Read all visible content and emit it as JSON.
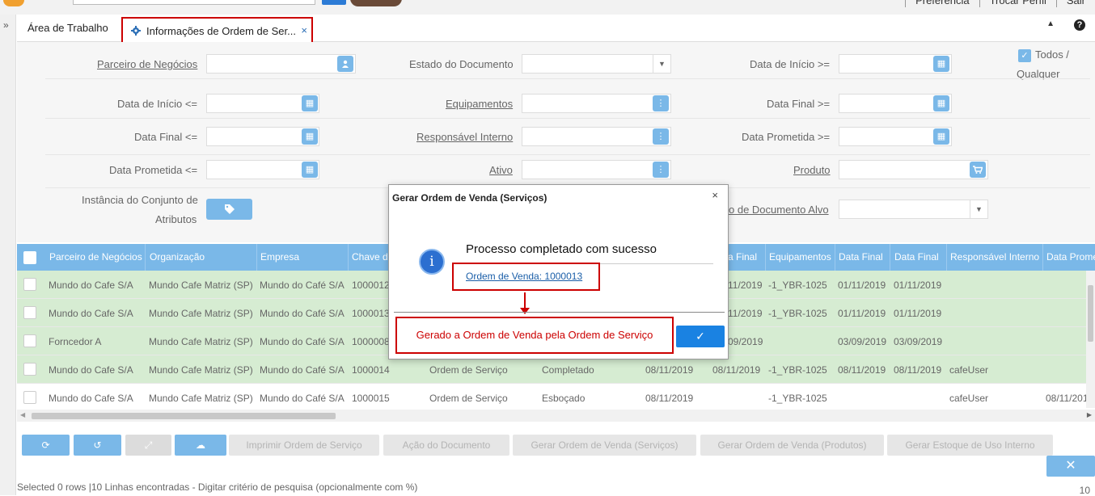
{
  "topbar": {
    "links": [
      "Preferência",
      "Trocar Perfil",
      "Sair"
    ]
  },
  "tabs": {
    "tab1": "Área de Trabalho",
    "tab2": "Informações de Ordem de Ser...",
    "close": "×",
    "up": "▲",
    "help": "?"
  },
  "leftstrip": {
    "chevron": "»"
  },
  "filters": {
    "parceiro": "Parceiro de Negócios",
    "estado": "Estado do Documento",
    "data_inicio_ge": "Data de Início >=",
    "todos": "Todos /",
    "qualquer": "Qualquer",
    "data_inicio_le": "Data de Início <=",
    "equipamentos": "Equipamentos",
    "data_final_ge": "Data Final >=",
    "data_final_le": "Data Final <=",
    "responsavel": "Responsável Interno",
    "data_prometida_ge": "Data Prometida >=",
    "data_prometida_le": "Data Prometida <=",
    "ativo": "Ativo",
    "produto": "Produto",
    "instancia_1": "Instância do Conjunto de",
    "instancia_2": "Atributos",
    "tipo_documento_alvo": "o de Documento Alvo"
  },
  "grid": {
    "headers": [
      "Parceiro de Negócios",
      "Organização",
      "Empresa",
      "Chave d",
      "a Final",
      "Equipamentos",
      "Data Final",
      "Data Final",
      "Responsável Interno",
      "Data Prome"
    ],
    "rows": [
      [
        "Mundo do Cafe S/A",
        "Mundo Cafe Matriz (SP)",
        "Mundo do Café S/A",
        "1000012",
        "",
        "",
        "",
        "11/2019",
        "-1_YBR-1025",
        "01/11/2019",
        "01/11/2019",
        "",
        ""
      ],
      [
        "Mundo do Cafe S/A",
        "Mundo Cafe Matriz (SP)",
        "Mundo do Café S/A",
        "1000013",
        "",
        "",
        "",
        "11/2019",
        "-1_YBR-1025",
        "01/11/2019",
        "01/11/2019",
        "",
        ""
      ],
      [
        "Forncedor A",
        "Mundo Cafe Matriz (SP)",
        "Mundo do Café S/A",
        "1000008",
        "",
        "",
        "",
        "09/2019",
        "",
        "03/09/2019",
        "03/09/2019",
        "",
        ""
      ],
      [
        "Mundo do Cafe S/A",
        "Mundo Cafe Matriz (SP)",
        "Mundo do Café S/A",
        "1000014",
        "Ordem de Serviço",
        "Completado",
        "08/11/2019",
        "08/11/2019",
        "-1_YBR-1025",
        "08/11/2019",
        "08/11/2019",
        "cafeUser",
        ""
      ],
      [
        "Mundo do Cafe S/A",
        "Mundo Cafe Matriz (SP)",
        "Mundo do Café S/A",
        "1000015",
        "Ordem de Serviço",
        "Esboçado",
        "08/11/2019",
        "",
        "-1_YBR-1025",
        "",
        "",
        "cafeUser",
        "08/11/201"
      ]
    ]
  },
  "toolbar": {
    "refresh": "⟳",
    "undo": "↺",
    "zoom": "⤢",
    "download": "☁",
    "imprimir": "Imprimir Ordem de Serviço",
    "acao": "Ação do Documento",
    "gerar_servicos": "Gerar Ordem de Venda (Serviços)",
    "gerar_produtos": "Gerar Ordem de Venda (Produtos)",
    "gerar_estoque": "Gerar Estoque de Uso Interno",
    "close": "✕"
  },
  "status": {
    "left": "Selected 0 rows |10 Linhas encontradas - Digitar critério de pesquisa (opcionalmente com %)",
    "right": "10"
  },
  "modal": {
    "title": "Gerar Ordem de Venda (Serviços)",
    "close": "×",
    "info": "i",
    "message": "Processo completado com sucesso",
    "link": "Ordem de Venda: 1000013",
    "annotation": "Gerado a Ordem de Venda pela Ordem de Serviço",
    "ok": "✓"
  }
}
